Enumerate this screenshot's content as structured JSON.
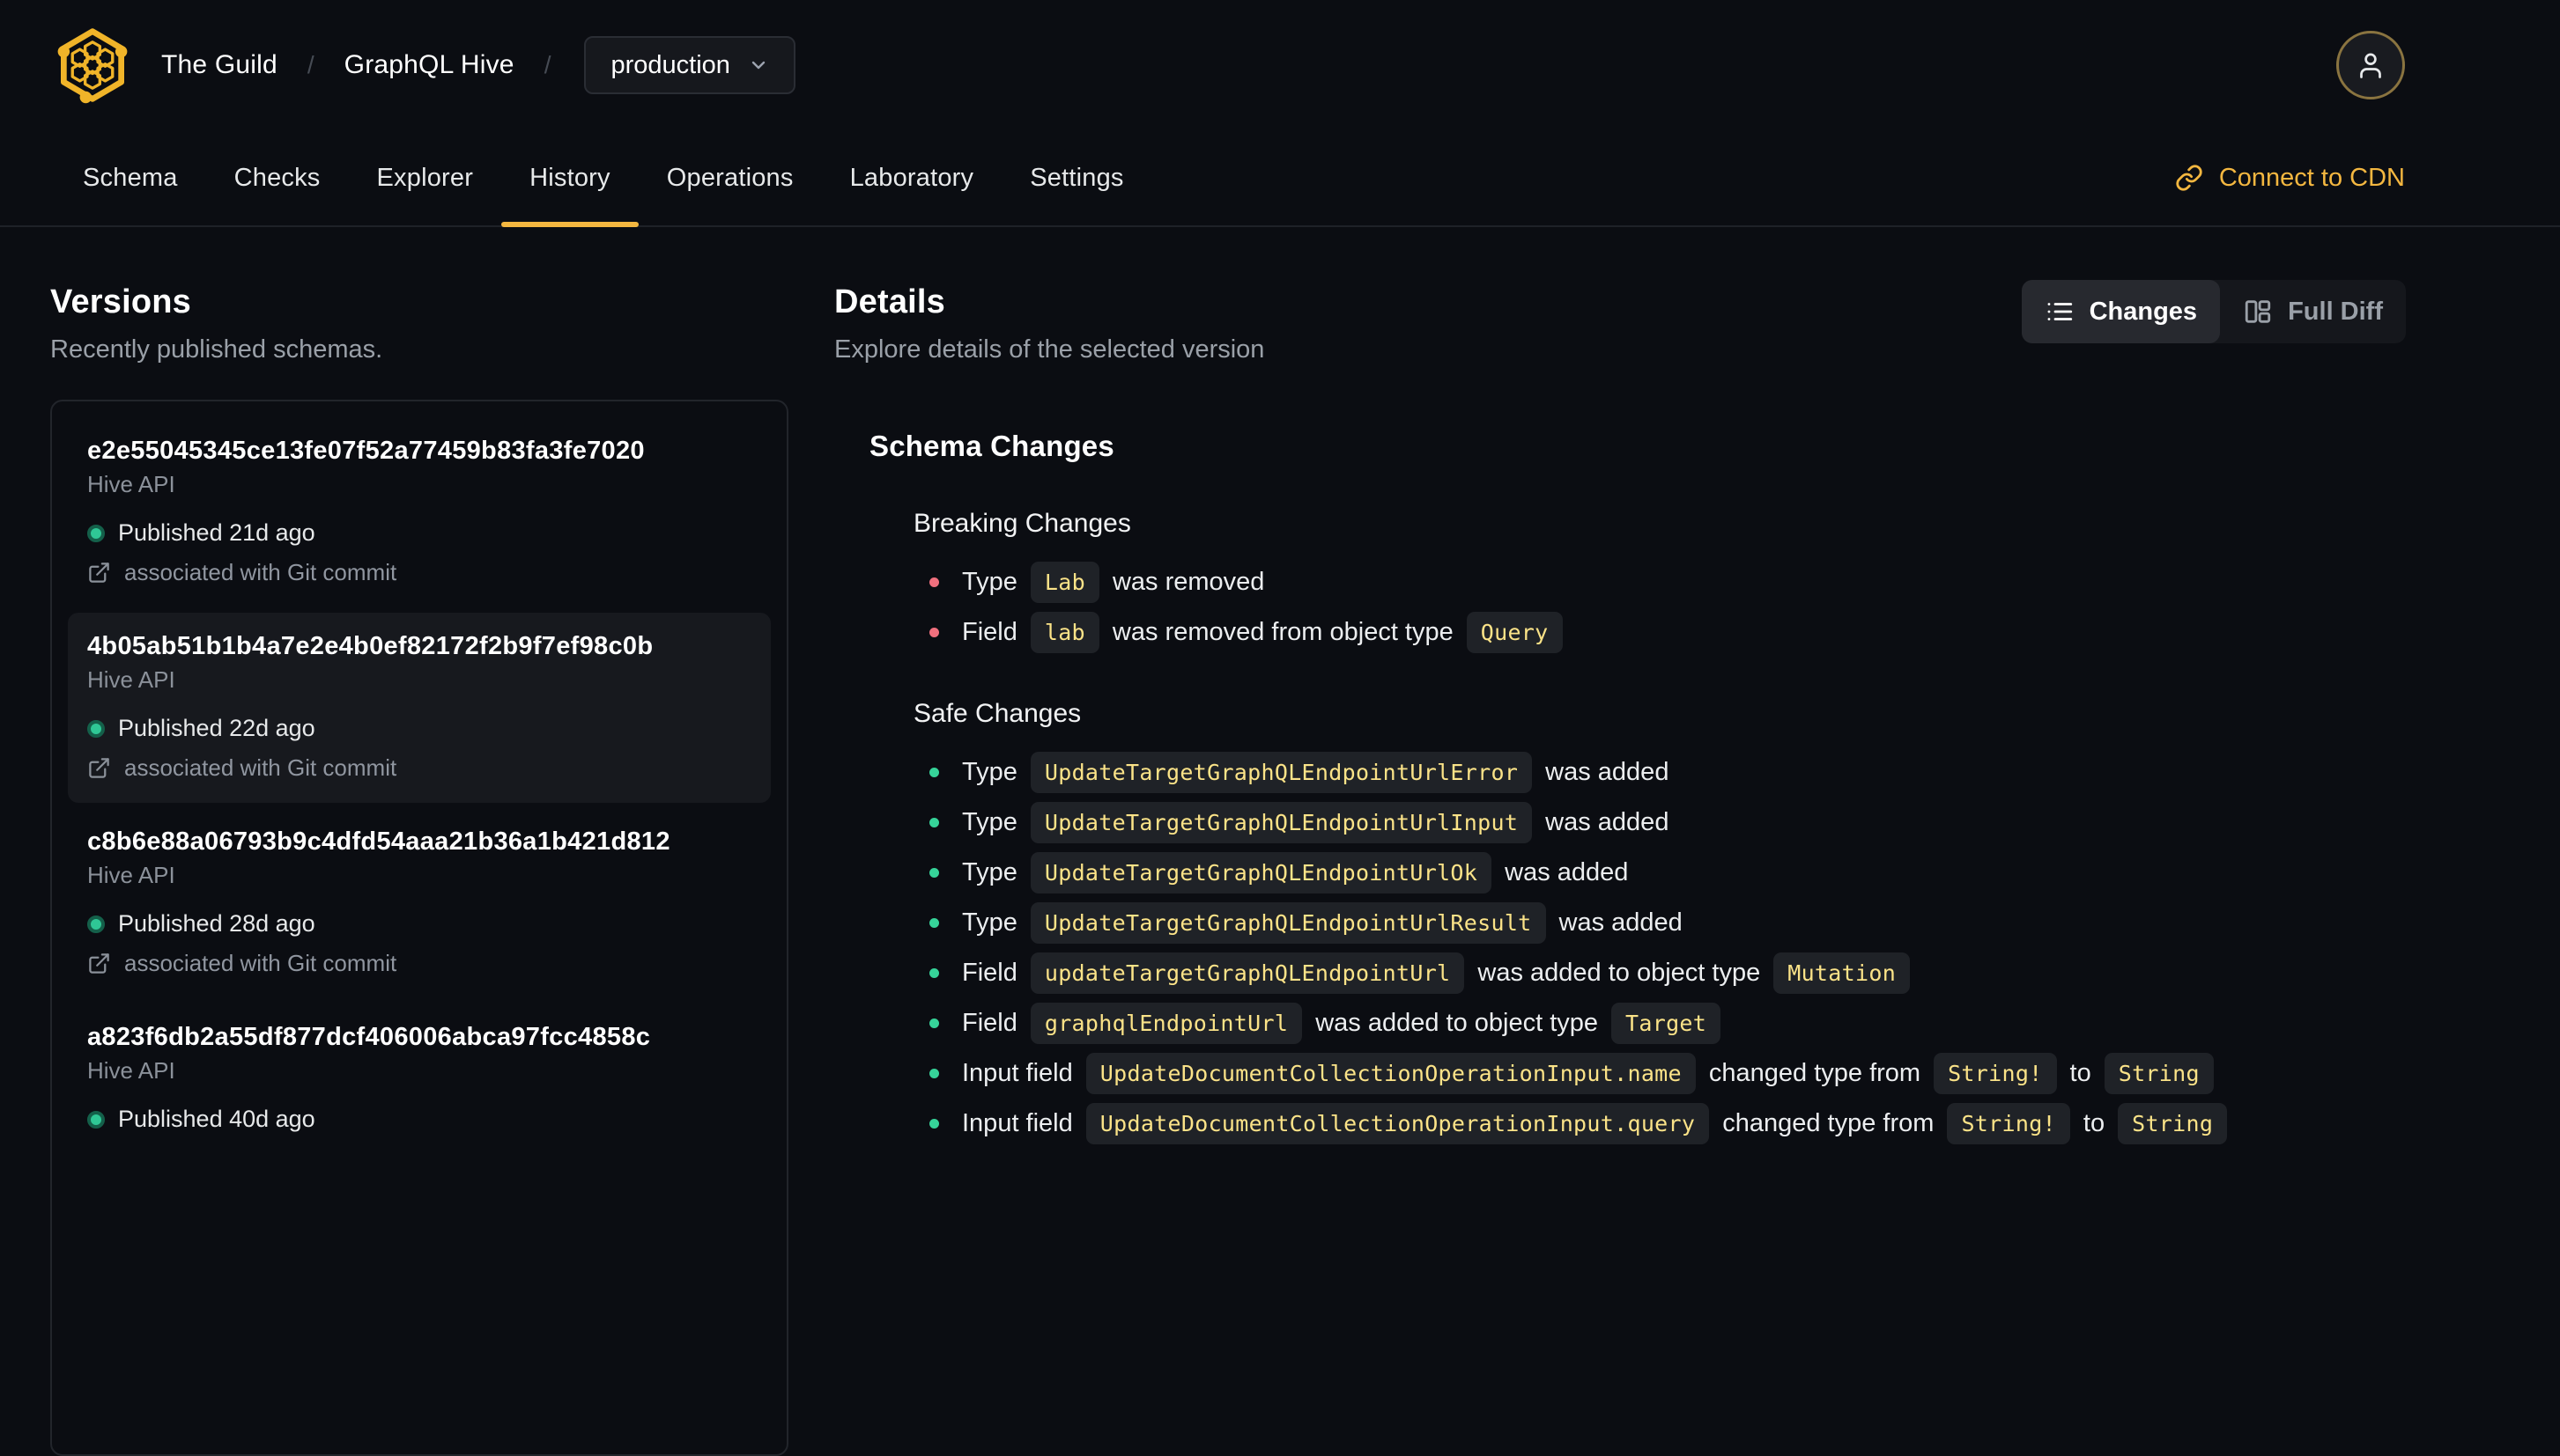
{
  "colors": {
    "accent": "#f4b740",
    "code_text": "#fbe388",
    "breaking_bullet": "#f0707e",
    "safe_bullet": "#36d399",
    "published_dot": "#2fc795"
  },
  "header": {
    "breadcrumb": {
      "org": "The Guild",
      "separator": "/",
      "project": "GraphQL Hive"
    },
    "target_selector": {
      "value": "production"
    },
    "tabs": [
      {
        "label": "Schema",
        "active": false
      },
      {
        "label": "Checks",
        "active": false
      },
      {
        "label": "Explorer",
        "active": false
      },
      {
        "label": "History",
        "active": true
      },
      {
        "label": "Operations",
        "active": false
      },
      {
        "label": "Laboratory",
        "active": false
      },
      {
        "label": "Settings",
        "active": false
      }
    ],
    "cdn_link": {
      "label": "Connect to CDN"
    }
  },
  "versions_panel": {
    "title": "Versions",
    "subtitle": "Recently published schemas.",
    "items": [
      {
        "hash": "e2e55045345ce13fe07f52a77459b83fa3fe7020",
        "service": "Hive API",
        "status": "Published 21d ago",
        "git_note": "associated with Git commit",
        "selected": false
      },
      {
        "hash": "4b05ab51b1b4a7e2e4b0ef82172f2b9f7ef98c0b",
        "service": "Hive API",
        "status": "Published 22d ago",
        "git_note": "associated with Git commit",
        "selected": true
      },
      {
        "hash": "c8b6e88a06793b9c4dfd54aaa21b36a1b421d812",
        "service": "Hive API",
        "status": "Published 28d ago",
        "git_note": "associated with Git commit",
        "selected": false
      },
      {
        "hash": "a823f6db2a55df877dcf406006abca97fcc4858c",
        "service": "Hive API",
        "status": "Published 40d ago",
        "selected": false
      }
    ]
  },
  "details_panel": {
    "title": "Details",
    "subtitle": "Explore details of the selected version",
    "view_toggle": [
      {
        "label": "Changes",
        "icon": "list",
        "active": true
      },
      {
        "label": "Full Diff",
        "icon": "columns",
        "active": false
      }
    ],
    "schema_changes": {
      "title": "Schema Changes",
      "groups": [
        {
          "title": "Breaking Changes",
          "severity": "breaking",
          "items": [
            [
              {
                "text": "Type"
              },
              {
                "code": "Lab"
              },
              {
                "text": "was removed"
              }
            ],
            [
              {
                "text": "Field"
              },
              {
                "code": "lab"
              },
              {
                "text": "was removed from object type"
              },
              {
                "code": "Query"
              }
            ]
          ]
        },
        {
          "title": "Safe Changes",
          "severity": "safe",
          "items": [
            [
              {
                "text": "Type"
              },
              {
                "code": "UpdateTargetGraphQLEndpointUrlError"
              },
              {
                "text": "was added"
              }
            ],
            [
              {
                "text": "Type"
              },
              {
                "code": "UpdateTargetGraphQLEndpointUrlInput"
              },
              {
                "text": "was added"
              }
            ],
            [
              {
                "text": "Type"
              },
              {
                "code": "UpdateTargetGraphQLEndpointUrlOk"
              },
              {
                "text": "was added"
              }
            ],
            [
              {
                "text": "Type"
              },
              {
                "code": "UpdateTargetGraphQLEndpointUrlResult"
              },
              {
                "text": "was added"
              }
            ],
            [
              {
                "text": "Field"
              },
              {
                "code": "updateTargetGraphQLEndpointUrl"
              },
              {
                "text": "was added to object type"
              },
              {
                "code": "Mutation"
              }
            ],
            [
              {
                "text": "Field"
              },
              {
                "code": "graphqlEndpointUrl"
              },
              {
                "text": "was added to object type"
              },
              {
                "code": "Target"
              }
            ],
            [
              {
                "text": "Input field"
              },
              {
                "code": "UpdateDocumentCollectionOperationInput.name"
              },
              {
                "text": "changed type from"
              },
              {
                "code": "String!"
              },
              {
                "text": "to"
              },
              {
                "code": "String"
              }
            ],
            [
              {
                "text": "Input field"
              },
              {
                "code": "UpdateDocumentCollectionOperationInput.query"
              },
              {
                "text": "changed type from"
              },
              {
                "code": "String!"
              },
              {
                "text": "to"
              },
              {
                "code": "String"
              }
            ]
          ]
        }
      ]
    }
  }
}
